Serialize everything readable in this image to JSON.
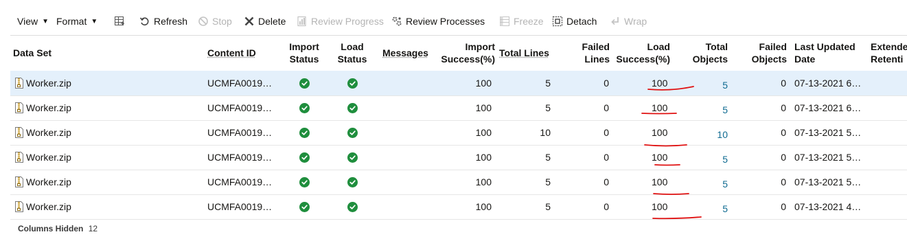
{
  "toolbar": {
    "view_label": "View",
    "format_label": "Format",
    "refresh_label": "Refresh",
    "stop_label": "Stop",
    "delete_label": "Delete",
    "review_progress_label": "Review Progress",
    "review_processes_label": "Review Processes",
    "freeze_label": "Freeze",
    "detach_label": "Detach",
    "wrap_label": "Wrap"
  },
  "columns": {
    "data_set": "Data Set",
    "content_id": "Content ID",
    "import_status_1": "Import",
    "import_status_2": "Status",
    "load_status_1": "Load",
    "load_status_2": "Status",
    "messages": "Messages",
    "import_success_1": "Import",
    "import_success_2": "Success(%)",
    "total_lines": "Total Lines",
    "failed_lines_1": "Failed",
    "failed_lines_2": "Lines",
    "load_success_1": "Load",
    "load_success_2": "Success(%)",
    "total_objects_1": "Total",
    "total_objects_2": "Objects",
    "failed_objects_1": "Failed",
    "failed_objects_2": "Objects",
    "last_updated_1": "Last Updated",
    "last_updated_2": "Date",
    "extended_1": "Extende",
    "extended_2": "Retenti"
  },
  "rows": [
    {
      "data_set": "Worker.zip",
      "content_id": "UCMFA0019…",
      "import_success": "100",
      "total_lines": "5",
      "failed_lines": "0",
      "load_success": "100",
      "total_objects": "5",
      "failed_objects": "0",
      "last_updated": "07-13-2021 6…"
    },
    {
      "data_set": "Worker.zip",
      "content_id": "UCMFA0019…",
      "import_success": "100",
      "total_lines": "5",
      "failed_lines": "0",
      "load_success": "100",
      "total_objects": "5",
      "failed_objects": "0",
      "last_updated": "07-13-2021 6…"
    },
    {
      "data_set": "Worker.zip",
      "content_id": "UCMFA0019…",
      "import_success": "100",
      "total_lines": "10",
      "failed_lines": "0",
      "load_success": "100",
      "total_objects": "10",
      "failed_objects": "0",
      "last_updated": "07-13-2021 5…"
    },
    {
      "data_set": "Worker.zip",
      "content_id": "UCMFA0019…",
      "import_success": "100",
      "total_lines": "5",
      "failed_lines": "0",
      "load_success": "100",
      "total_objects": "5",
      "failed_objects": "0",
      "last_updated": "07-13-2021 5…"
    },
    {
      "data_set": "Worker.zip",
      "content_id": "UCMFA0019…",
      "import_success": "100",
      "total_lines": "5",
      "failed_lines": "0",
      "load_success": "100",
      "total_objects": "5",
      "failed_objects": "0",
      "last_updated": "07-13-2021 5…"
    },
    {
      "data_set": "Worker.zip",
      "content_id": "UCMFA0019…",
      "import_success": "100",
      "total_lines": "5",
      "failed_lines": "0",
      "load_success": "100",
      "total_objects": "5",
      "failed_objects": "0",
      "last_updated": "07-13-2021 4…"
    }
  ],
  "footer": {
    "columns_hidden_label": "Columns Hidden",
    "columns_hidden_count": "12"
  },
  "colors": {
    "selected_row": "#e4f0fb",
    "status_ok": "#1f8e3d",
    "link": "#0f6b91",
    "annotation": "#e01010"
  },
  "icons": {
    "status": "check-circle-icon",
    "file": "zip-file-icon"
  }
}
